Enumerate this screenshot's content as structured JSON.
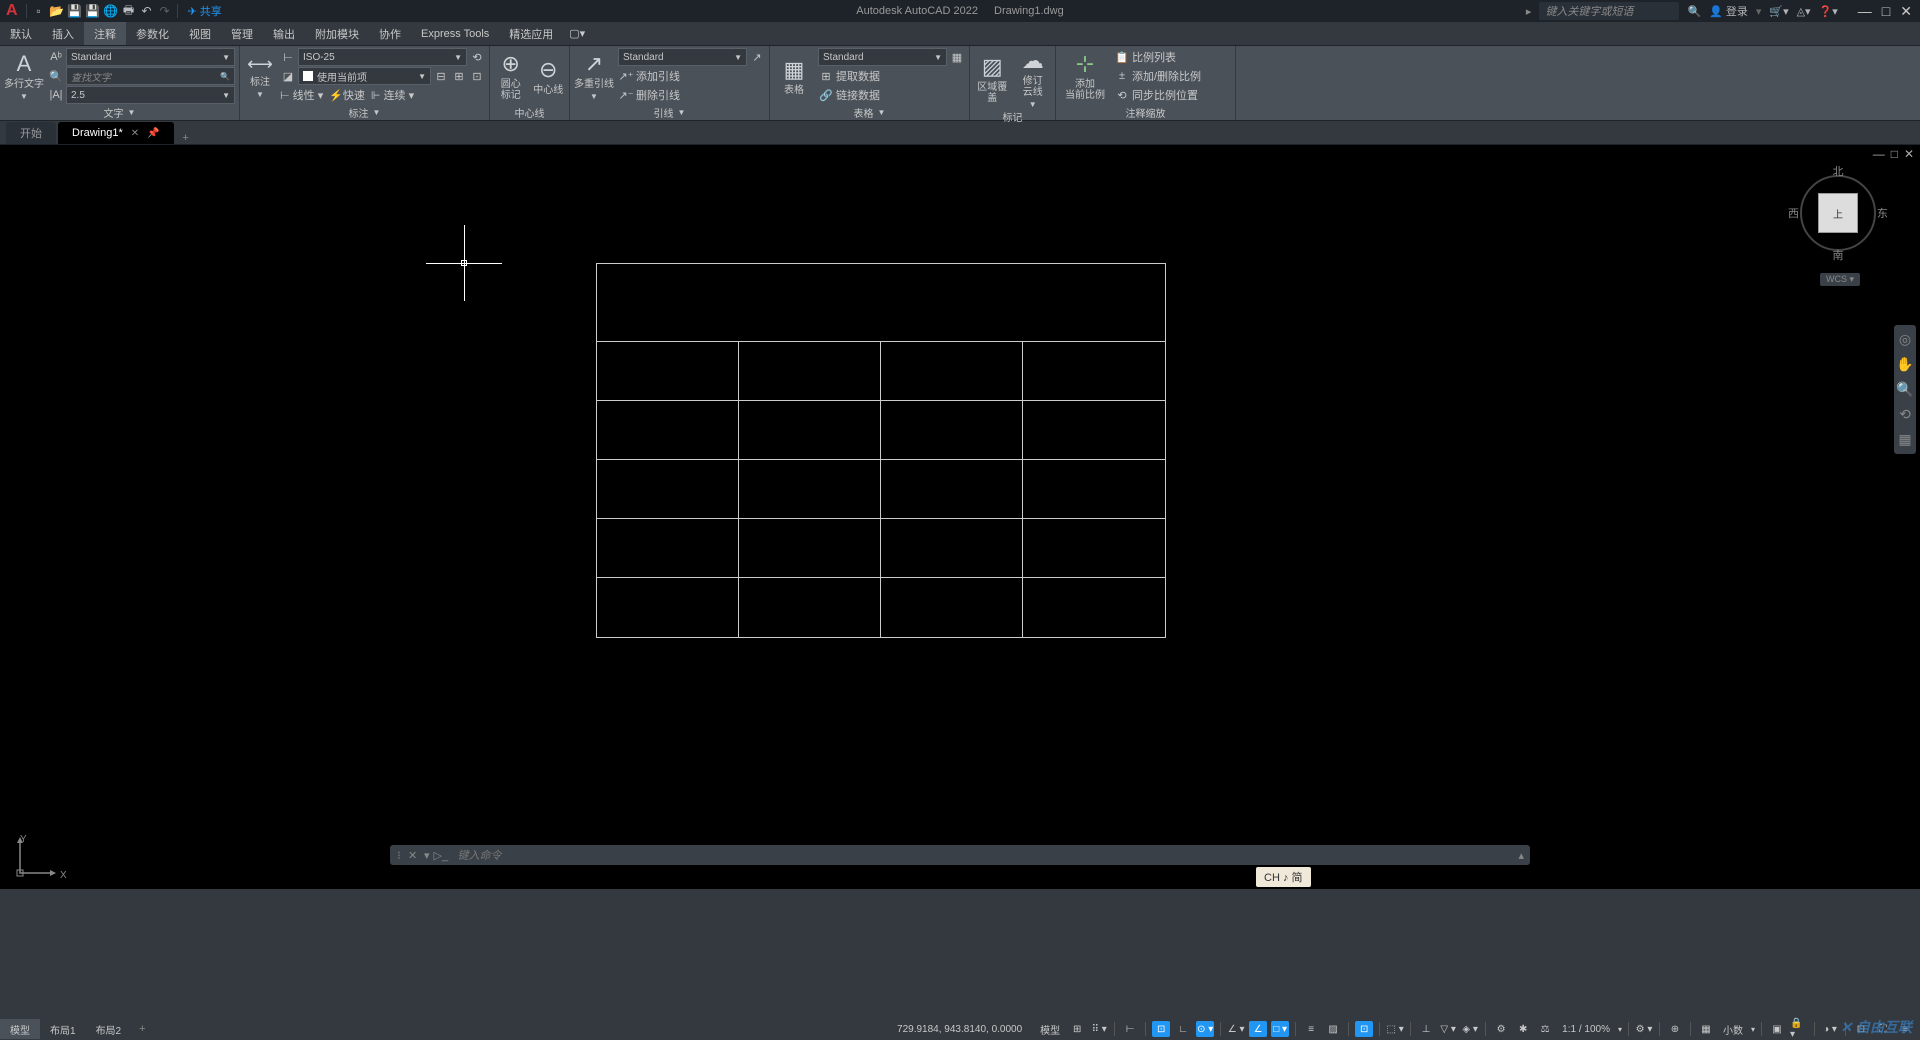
{
  "app": {
    "name": "Autodesk AutoCAD 2022",
    "file": "Drawing1.dwg"
  },
  "qat": {
    "share": "共享"
  },
  "title_right": {
    "search_placeholder": "键入关键字或短语",
    "login": "登录"
  },
  "menu": {
    "tabs": [
      "默认",
      "插入",
      "注释",
      "参数化",
      "视图",
      "管理",
      "输出",
      "附加模块",
      "协作",
      "Express Tools",
      "精选应用"
    ],
    "active_index": 2
  },
  "ribbon": {
    "text_panel": {
      "big": "多行文字",
      "combo1": "Standard",
      "combo2": "查找文字",
      "combo3": "2.5",
      "title": "文字"
    },
    "dim_panel": {
      "big": "标注",
      "combo1": "ISO-25",
      "layer": "使用当前项",
      "linear": "线性",
      "quick": "快速",
      "continue": "连续",
      "title": "标注"
    },
    "center_panel": {
      "btn1": "圆心\n标记",
      "btn2": "中心线",
      "title": "中心线"
    },
    "leader_panel": {
      "big": "多重引线",
      "combo": "Standard",
      "add": "添加引线",
      "remove": "删除引线",
      "title": "引线"
    },
    "table_panel": {
      "big": "表格",
      "combo": "Standard",
      "extract": "提取数据",
      "link": "链接数据",
      "title": "表格"
    },
    "markup_panel": {
      "btn1": "区域覆盖",
      "btn2": "修订\n云线",
      "title": "标记"
    },
    "scale_panel": {
      "big": "添加\n当前比例",
      "list": "比例列表",
      "adddel": "添加/删除比例",
      "sync": "同步比例位置",
      "title": "注释缩放"
    }
  },
  "doc_tabs": {
    "start": "开始",
    "drawing": "Drawing1*"
  },
  "viewcube": {
    "n": "北",
    "s": "南",
    "e": "东",
    "w": "西",
    "top": "上",
    "wcs": "WCS"
  },
  "ucs": {
    "x": "X",
    "y": "Y"
  },
  "ime": "CH ♪ 简",
  "cmd": {
    "placeholder": "键入命令"
  },
  "layout": {
    "model": "模型",
    "l1": "布局1",
    "l2": "布局2"
  },
  "status": {
    "coords": "729.9184, 943.8140, 0.0000",
    "model": "模型",
    "scale": "1:1 / 100%",
    "decimal": "小数"
  },
  "watermark": "自由互联"
}
